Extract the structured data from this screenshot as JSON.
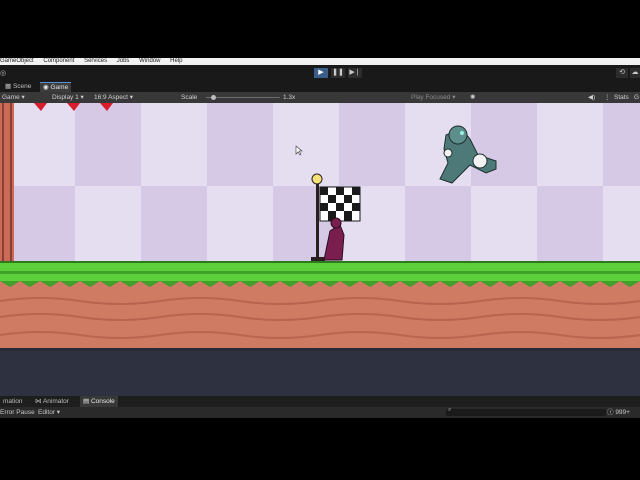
{
  "menubar": {
    "items": [
      "GameObject",
      "Component",
      "Services",
      "Jobs",
      "Window",
      "Help"
    ]
  },
  "toolbar": {
    "play_icon": "play-icon",
    "pause_icon": "pause-icon",
    "step_icon": "step-icon",
    "play_active": true
  },
  "view_tabs": [
    {
      "label": "Scene",
      "icon": "scene-icon"
    },
    {
      "label": "Game",
      "icon": "game-icon",
      "active": true
    }
  ],
  "game_bar": {
    "game_mode": "Game",
    "display": "Display 1",
    "aspect": "16:9 Aspect",
    "scale_label": "Scale",
    "scale_value": "1.3x",
    "scale_fraction": 0.07,
    "play_mode": "Play Focused",
    "stats": "Stats",
    "gizmos": "G"
  },
  "bottom_tabs": [
    {
      "label": "mation"
    },
    {
      "label": "Animator"
    },
    {
      "label": "Console",
      "active": true
    }
  ],
  "console_bar": {
    "error_pause": "Error Pause",
    "editor": "Editor",
    "log_count": "999+"
  },
  "game": {
    "hearts": 3,
    "colors": {
      "grass": "#5ccf3a",
      "dirt": "#cf7a62",
      "checker_light": "#e4def0",
      "checker_dark": "#d4c6e4",
      "player": "#7a1d4f",
      "enemy": "#4d7a78"
    }
  }
}
